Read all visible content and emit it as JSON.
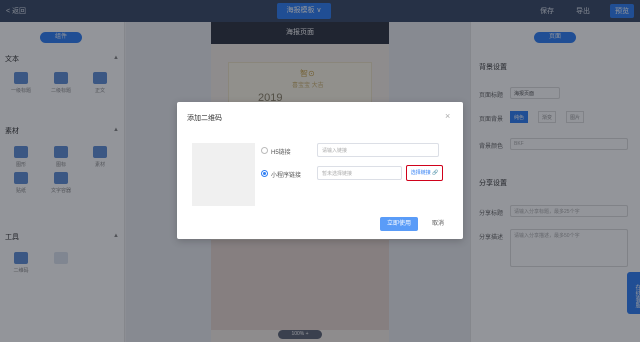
{
  "topbar": {
    "back": "< 返回",
    "title": "海报模板 ∨",
    "save": "保存",
    "export": "导出",
    "preview": "预览"
  },
  "left": {
    "layout_btn": "组件",
    "sections": [
      {
        "name": "文本",
        "tools": [
          "一级标题",
          "二级标题",
          "正文"
        ]
      },
      {
        "name": "素材",
        "tools": [
          "图形",
          "图标",
          "素材",
          "贴纸",
          "文字容器"
        ]
      },
      {
        "name": "工具",
        "tools": [
          "二维码",
          ""
        ]
      }
    ]
  },
  "canvas": {
    "page_title": "海报页面",
    "poster_year": "2019",
    "poster_wish": "智⊙",
    "poster_sub": "喜宝宝 大吉",
    "zoom": "100% +"
  },
  "right": {
    "tab": "页面",
    "section1": "背景设置",
    "row1_label": "页面标题",
    "row1_value": "海报页面",
    "row2_label": "页面背景",
    "segs": [
      "纯色",
      "渐变",
      "图片"
    ],
    "row3_label": "背景颜色",
    "row3_value": "BKF",
    "section2": "分享设置",
    "share_title_label": "分享标题",
    "share_title_ph": "请输入分享标题，最多25个字",
    "share_desc_label": "分享描述",
    "share_desc_ph": "请输入分享描述，最多50个字"
  },
  "sidetab": "在线客服",
  "modal": {
    "title": "添加二维码",
    "h5_label": "H5链接",
    "h5_placeholder": "请输入链接",
    "mini_label": "小程序链接",
    "mini_placeholder": "暂未选择链接",
    "select_page": "选择链接 🔗",
    "confirm": "立即使用",
    "cancel": "取消",
    "close": "×"
  },
  "colors": {
    "accent": "#2f7ef4",
    "topbar": "#3a4a66",
    "highlight_border": "#d0021b"
  }
}
